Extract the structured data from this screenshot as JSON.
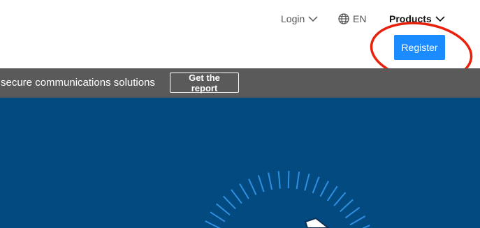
{
  "header": {
    "login_label": "Login",
    "language_label": "EN",
    "products_label": "Products",
    "register_label": "Register"
  },
  "banner": {
    "text": "secure communications solutions",
    "cta_label": "Get the report"
  },
  "colors": {
    "accent": "#1a8cff",
    "banner_bg": "#5a5a5a",
    "hero_bg": "#034a80",
    "annotation": "#e8200c"
  }
}
